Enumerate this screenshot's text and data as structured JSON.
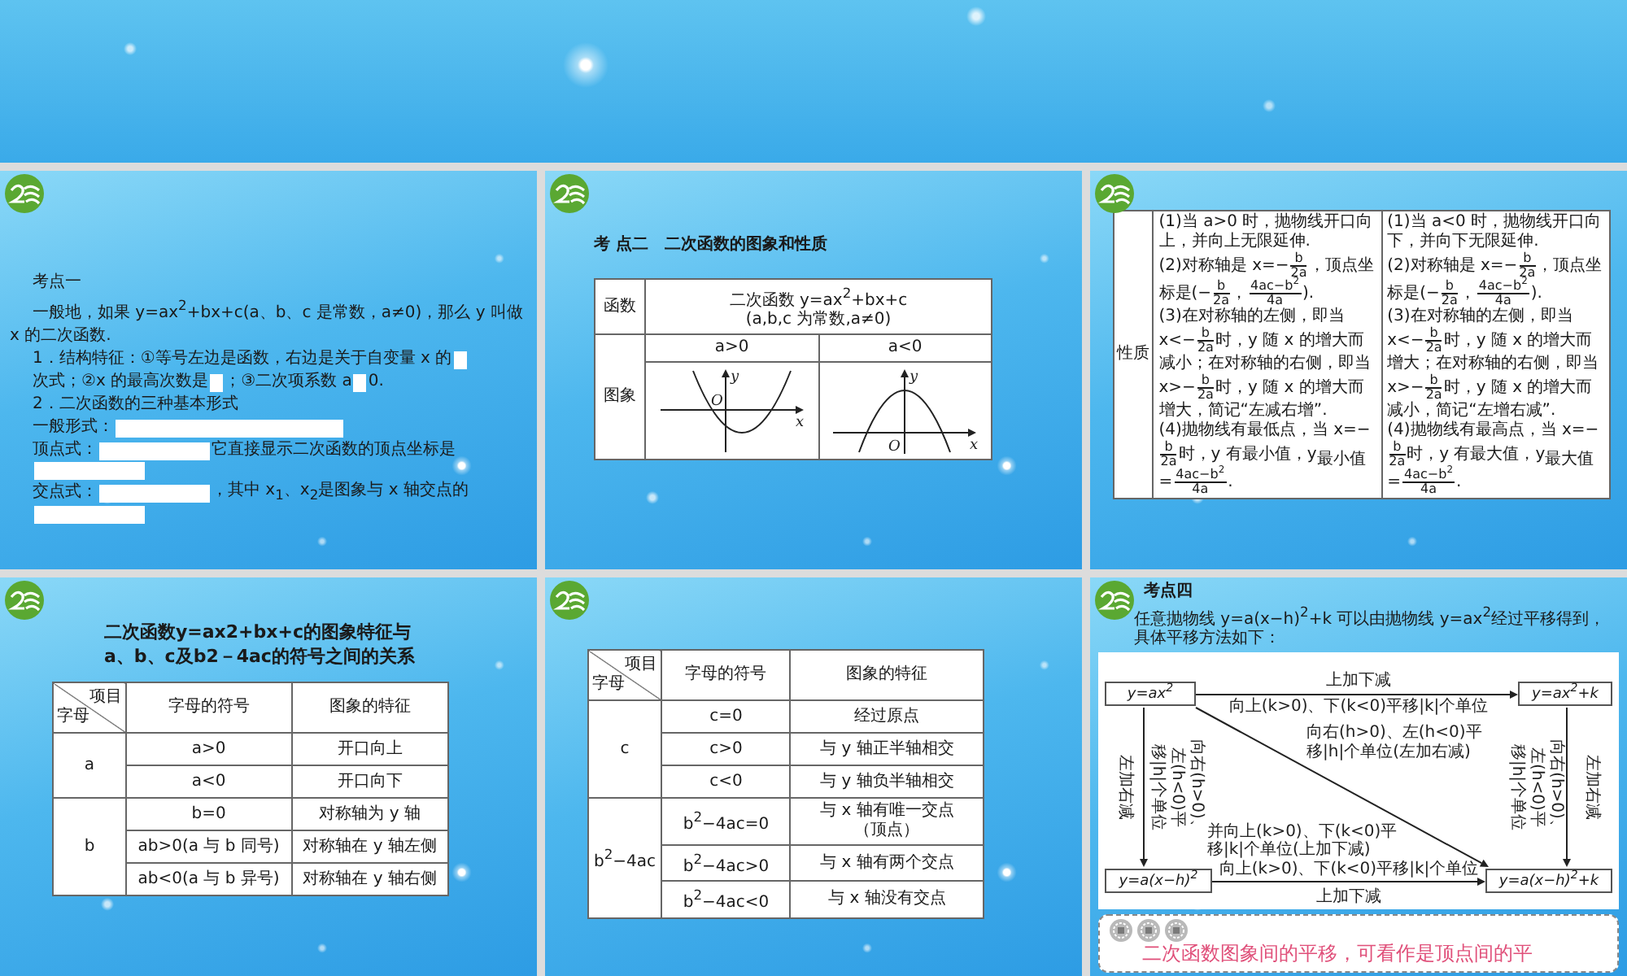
{
  "slides": [
    {
      "kind": "blank"
    },
    {
      "kind": "notes",
      "paragraphs": [
        [
          {
            "kind": "text",
            "text": "考点一"
          }
        ],
        [
          {
            "kind": "text",
            "text": "一般地，如果 y=ax$^{2}$+bx+c(a、b、c 是常数，a≠0)，那么 y 叫做 x 的二次函数."
          }
        ],
        [
          {
            "kind": "text",
            "text": "1．结构特征：①等号左边是函数，右边是关于自变量 x 的"
          },
          {
            "kind": "short_blank"
          },
          {
            "kind": "text",
            "text": "次式；②x 的最高次数是"
          },
          {
            "kind": "short_blank"
          },
          {
            "kind": "text",
            "text": "；③二次项系数 a"
          },
          {
            "kind": "short_blank"
          },
          {
            "kind": "text",
            "text": "0."
          }
        ],
        [
          {
            "kind": "text",
            "text": "2．二次函数的三种基本形式"
          }
        ],
        [
          {
            "kind": "text",
            "text": "一般形式："
          },
          {
            "kind": "long_blank"
          }
        ],
        [
          {
            "kind": "text",
            "text": "顶点式："
          },
          {
            "kind": "medium_blank"
          },
          {
            "kind": "text",
            "text": "它直接显示二次函数的顶点坐标是"
          },
          {
            "kind": "medium_blank"
          }
        ],
        [
          {
            "kind": "text",
            "text": "交点式："
          },
          {
            "kind": "medium_blank"
          },
          {
            "kind": "text",
            "text": "，其中 x$_{1}$、x$_{2}$是图象与 x 轴交点的"
          },
          {
            "kind": "medium_blank"
          }
        ]
      ]
    },
    {
      "kind": "graph_table",
      "title": "考 点二　二次函数的图象和性质",
      "function_label": "函数",
      "function_lines": [
        "二次函数 y=ax$^{2}$+bx+c",
        "(a,b,c 为常数,a≠0)"
      ],
      "graph_label": "图象",
      "graphs": [
        {
          "condition": "a>0",
          "kind": "upward",
          "labels": {
            "y_axis": "y",
            "origin": "O",
            "x_axis": "x"
          }
        },
        {
          "condition": "a<0",
          "kind": "downward",
          "labels": {
            "y_axis": "y",
            "origin": "O",
            "x_axis": "x"
          }
        }
      ]
    },
    {
      "kind": "property_table",
      "label": "性质",
      "columns": [
        [
          [
            "(1)当 a>0 时，抛物线开口向上，并向上无限延伸."
          ],
          [
            "(2)对称轴是 x=−",
            {
              "kind": "fraction",
              "num": "b",
              "den": "2a"
            },
            "，顶点坐标是(−",
            {
              "kind": "fraction",
              "num": "b",
              "den": "2a"
            },
            "，",
            {
              "kind": "fraction",
              "num": "4ac−b$^{2}$",
              "den": "4a"
            },
            ")."
          ],
          [
            "(3)在对称轴的左侧，即当 x<−",
            {
              "kind": "fraction",
              "num": "b",
              "den": "2a"
            },
            "时，y 随 x 的增大而减小；在对称轴的右侧，即当 x>−",
            {
              "kind": "fraction",
              "num": "b",
              "den": "2a"
            },
            "时，y 随 x 的增大而增大，简记“左减右增”."
          ],
          [
            "(4)抛物线有最低点，当 x=−",
            {
              "kind": "fraction",
              "num": "b",
              "den": "2a"
            },
            "时，y 有最小值，y$_{最小值}$=",
            {
              "kind": "fraction",
              "num": "4ac−b$^{2}$",
              "den": "4a"
            },
            "."
          ]
        ],
        [
          [
            "(1)当 a<0 时，抛物线开口向下，并向下无限延伸."
          ],
          [
            "(2)对称轴是 x=−",
            {
              "kind": "fraction",
              "num": "b",
              "den": "2a"
            },
            "，顶点坐标是(−",
            {
              "kind": "fraction",
              "num": "b",
              "den": "2a"
            },
            "，",
            {
              "kind": "fraction",
              "num": "4ac−b$^{2}$",
              "den": "4a"
            },
            ")."
          ],
          [
            "(3)在对称轴的左侧，即当 x<−",
            {
              "kind": "fraction",
              "num": "b",
              "den": "2a"
            },
            "时，y 随 x 的增大而增大；在对称轴的右侧，即当 x>−",
            {
              "kind": "fraction",
              "num": "b",
              "den": "2a"
            },
            "时，y 随 x 的增大而减小，简记“左增右减”."
          ],
          [
            "(4)抛物线有最高点，当 x=−",
            {
              "kind": "fraction",
              "num": "b",
              "den": "2a"
            },
            "时，y 有最大值，y$_{最大值}$=",
            {
              "kind": "fraction",
              "num": "4ac−b$^{2}$",
              "den": "4a"
            },
            "."
          ]
        ]
      ]
    },
    {
      "kind": "sign_table",
      "title_lines": [
        "二次函数y=ax2+bx+c的图象特征与",
        "a、b、c及b2－4ac的符号之间的关系"
      ],
      "header": {
        "corner_top": "项目",
        "corner_bottom": "字母",
        "columns": [
          "字母的符号",
          "图象的特征"
        ]
      },
      "groups": [
        {
          "letter": "a",
          "rows": [
            {
              "sign": "a>0",
              "feature_lines": [
                "开口向上"
              ]
            },
            {
              "sign": "a<0",
              "feature_lines": [
                "开口向下"
              ]
            }
          ]
        },
        {
          "letter": "b",
          "rows": [
            {
              "sign": "b=0",
              "feature_lines": [
                "对称轴为 y 轴"
              ]
            },
            {
              "sign": "ab>0(a 与 b 同号)",
              "feature_lines": [
                "对称轴在 y 轴左侧"
              ]
            },
            {
              "sign": "ab<0(a 与 b 异号)",
              "feature_lines": [
                "对称轴在 y 轴右侧"
              ]
            }
          ]
        }
      ]
    },
    {
      "kind": "sign_table",
      "header": {
        "corner_top": "项目",
        "corner_bottom": "字母",
        "columns": [
          "字母的符号",
          "图象的特征"
        ]
      },
      "groups": [
        {
          "letter": "c",
          "rows": [
            {
              "sign": "c=0",
              "feature_lines": [
                "经过原点"
              ]
            },
            {
              "sign": "c>0",
              "feature_lines": [
                "与 y 轴正半轴相交"
              ]
            },
            {
              "sign": "c<0",
              "feature_lines": [
                "与 y 轴负半轴相交"
              ]
            }
          ]
        },
        {
          "letter": "b$^{2}$−4ac",
          "rows": [
            {
              "sign": "b$^{2}$−4ac=0",
              "feature_lines": [
                "与 x 轴有唯一交点",
                "（顶点）"
              ]
            },
            {
              "sign": "b$^{2}$−4ac>0",
              "feature_lines": [
                "与 x 轴有两个交点"
              ]
            },
            {
              "sign": "b$^{2}$−4ac<0",
              "feature_lines": [
                "与 x 轴没有交点"
              ]
            }
          ]
        }
      ]
    },
    {
      "kind": "translation_diagram",
      "heading": "考点四",
      "intro": "任意抛物线 y=a(x−h)$^{2}$+k 可以由抛物线 y=ax$^{2}$经过平移得到，具体平移方法如下：",
      "boxes": [
        "y=ax$^{2}$",
        "y=ax$^{2}$+k",
        "y=a(x−h)$^{2}$",
        "y=a(x−h)$^{2}$+k"
      ],
      "arrows": [
        {
          "kind": "top",
          "labels": [
            "上加下减",
            "向上(k>0)、下(k<0)平移|k|个单位"
          ]
        },
        {
          "kind": "left",
          "labels": [
            "左加右减",
            "向右(h>0)、左(h<0)平移|h|个单位"
          ]
        },
        {
          "kind": "diagonal",
          "labels": [
            "向右(h>0)、左(h<0)平移|h|个单位(左加右减)",
            "并向上(k>0)、下(k<0)平移|k|个单位(上加下减)"
          ]
        },
        {
          "kind": "right",
          "labels": [
            "左加右减",
            "向右(h>0)、左(h<0)平移|h|个单位"
          ]
        },
        {
          "kind": "bottom",
          "labels": [
            "向上(k>0)、下(k<0)平移|k|个单位",
            "上加下减"
          ]
        }
      ],
      "note": "二次函数图象间的平移，可看作是顶点间的平"
    }
  ]
}
